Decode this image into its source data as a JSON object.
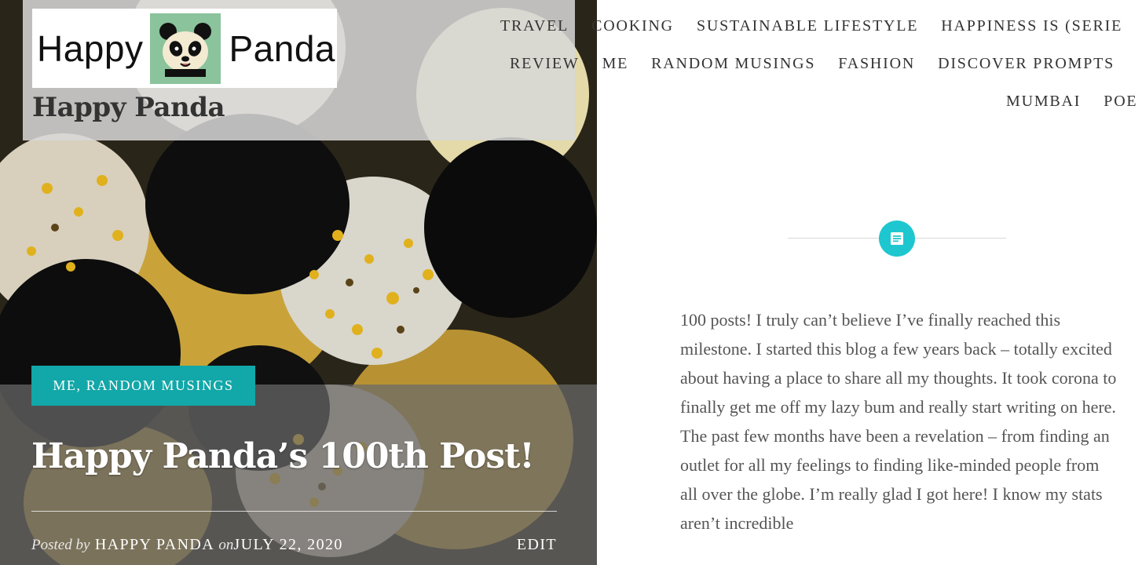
{
  "site": {
    "logo_left_word": "Happy",
    "logo_right_word": "Panda",
    "title": "Happy Panda"
  },
  "nav": {
    "row1": [
      "TRAVEL",
      "COOKING",
      "SUSTAINABLE LIFESTYLE",
      "HAPPINESS IS (SERIE"
    ],
    "row2": [
      "REVIEW",
      "ME",
      "RANDOM MUSINGS",
      "FASHION",
      "DISCOVER PROMPTS"
    ],
    "row3": [
      "MUMBAI",
      "POE"
    ]
  },
  "post": {
    "categories": "ME, RANDOM MUSINGS",
    "title": "Happy Panda’s 100th Post!",
    "posted_by_label": "Posted by",
    "author": "HAPPY PANDA",
    "on_label": "on",
    "date": "JULY 22, 2020",
    "edit_label": "EDIT",
    "format_icon": "text-document-icon",
    "body": "100 posts! I truly can’t believe I’ve finally reached this milestone. I started this blog a few years back – totally excited about having a place to share all my thoughts. It took corona to finally get me off my lazy bum and really start writing on here. The past few months have been a revelation – from finding an outlet for all my feelings to finding like-minded people from all over the globe. I’m really glad I got here! I know my stats aren’t incredible"
  },
  "colors": {
    "accent": "#12a7a8",
    "icon_bg": "#1ec7cf",
    "text": "#555555"
  }
}
